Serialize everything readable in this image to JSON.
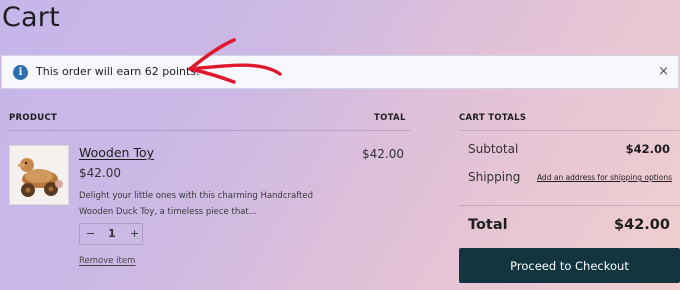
{
  "page": {
    "title": "Cart"
  },
  "notice": {
    "text": "This order will earn 62 points.",
    "info_icon": "info-icon",
    "close_glyph": "×"
  },
  "cart_table": {
    "headers": {
      "product": "PRODUCT",
      "total": "TOTAL"
    },
    "items": [
      {
        "name": "Wooden Toy",
        "price": "$42.00",
        "description": "Delight your little ones with this charming Handcrafted Wooden Duck Toy, a timeless piece that...",
        "quantity": "1",
        "decrement": "−",
        "increment": "+",
        "remove_label": "Remove item",
        "line_total": "$42.00"
      }
    ]
  },
  "cart_totals": {
    "heading": "CART TOTALS",
    "subtotal_label": "Subtotal",
    "subtotal_value": "$42.00",
    "shipping_label": "Shipping",
    "shipping_link": "Add an address for shipping options",
    "total_label": "Total",
    "total_value": "$42.00",
    "checkout_label": "Proceed to Checkout"
  },
  "colors": {
    "checkout_button": "#123540",
    "info_icon": "#2c6fb0",
    "annotation_arrow": "#e0182d"
  }
}
